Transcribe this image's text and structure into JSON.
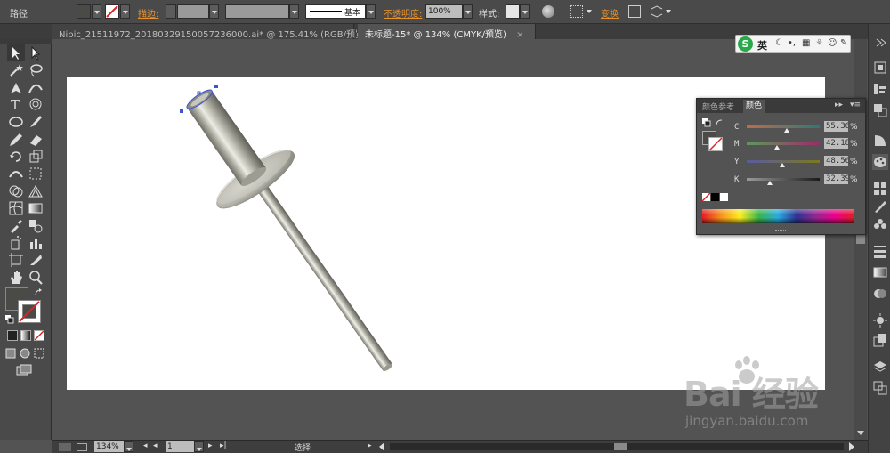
{
  "topbar": {
    "object_type": "路径",
    "stroke_label": "描边:",
    "stroke_profile": "基本",
    "opacity_label": "不透明度:",
    "opacity_value": "100%",
    "style_label": "样式:",
    "transform_label": "变换"
  },
  "tabs": [
    {
      "label": "Nipic_21511972_20180329150057236000.ai* @ 175.41% (RGB/预览)",
      "active": false
    },
    {
      "label": "未标题-15* @ 134% (CMYK/预览)",
      "active": true
    }
  ],
  "tab_close": "×",
  "color_panel": {
    "tab_guide": "颜色参考",
    "tab_color": "颜色",
    "sliders": [
      {
        "label": "C",
        "value": "55.36",
        "level": 0.55,
        "color_from": "#c06a4a",
        "color_to": "#2a7a7a"
      },
      {
        "label": "M",
        "value": "42.18",
        "level": 0.42,
        "color_from": "#5a9a5a",
        "color_to": "#a02a6a"
      },
      {
        "label": "Y",
        "value": "48.56",
        "level": 0.49,
        "color_from": "#5a5aa0",
        "color_to": "#7a7a20"
      },
      {
        "label": "K",
        "value": "32.39",
        "level": 0.32,
        "color_from": "#9a9a9a",
        "color_to": "#1a1a1a"
      }
    ],
    "unit": "%"
  },
  "status": {
    "zoom": "134%",
    "artboard_index": "1",
    "tool_name": "选择"
  },
  "ime": {
    "logo": "S",
    "mode": "英"
  },
  "watermark": {
    "logo": "Bai 经验",
    "url": "jingyan.baidu.com"
  },
  "colors": {
    "fill_swatch": "#4a4a46",
    "artboard": "#ffffff",
    "accent_orange": "#e8912a"
  }
}
